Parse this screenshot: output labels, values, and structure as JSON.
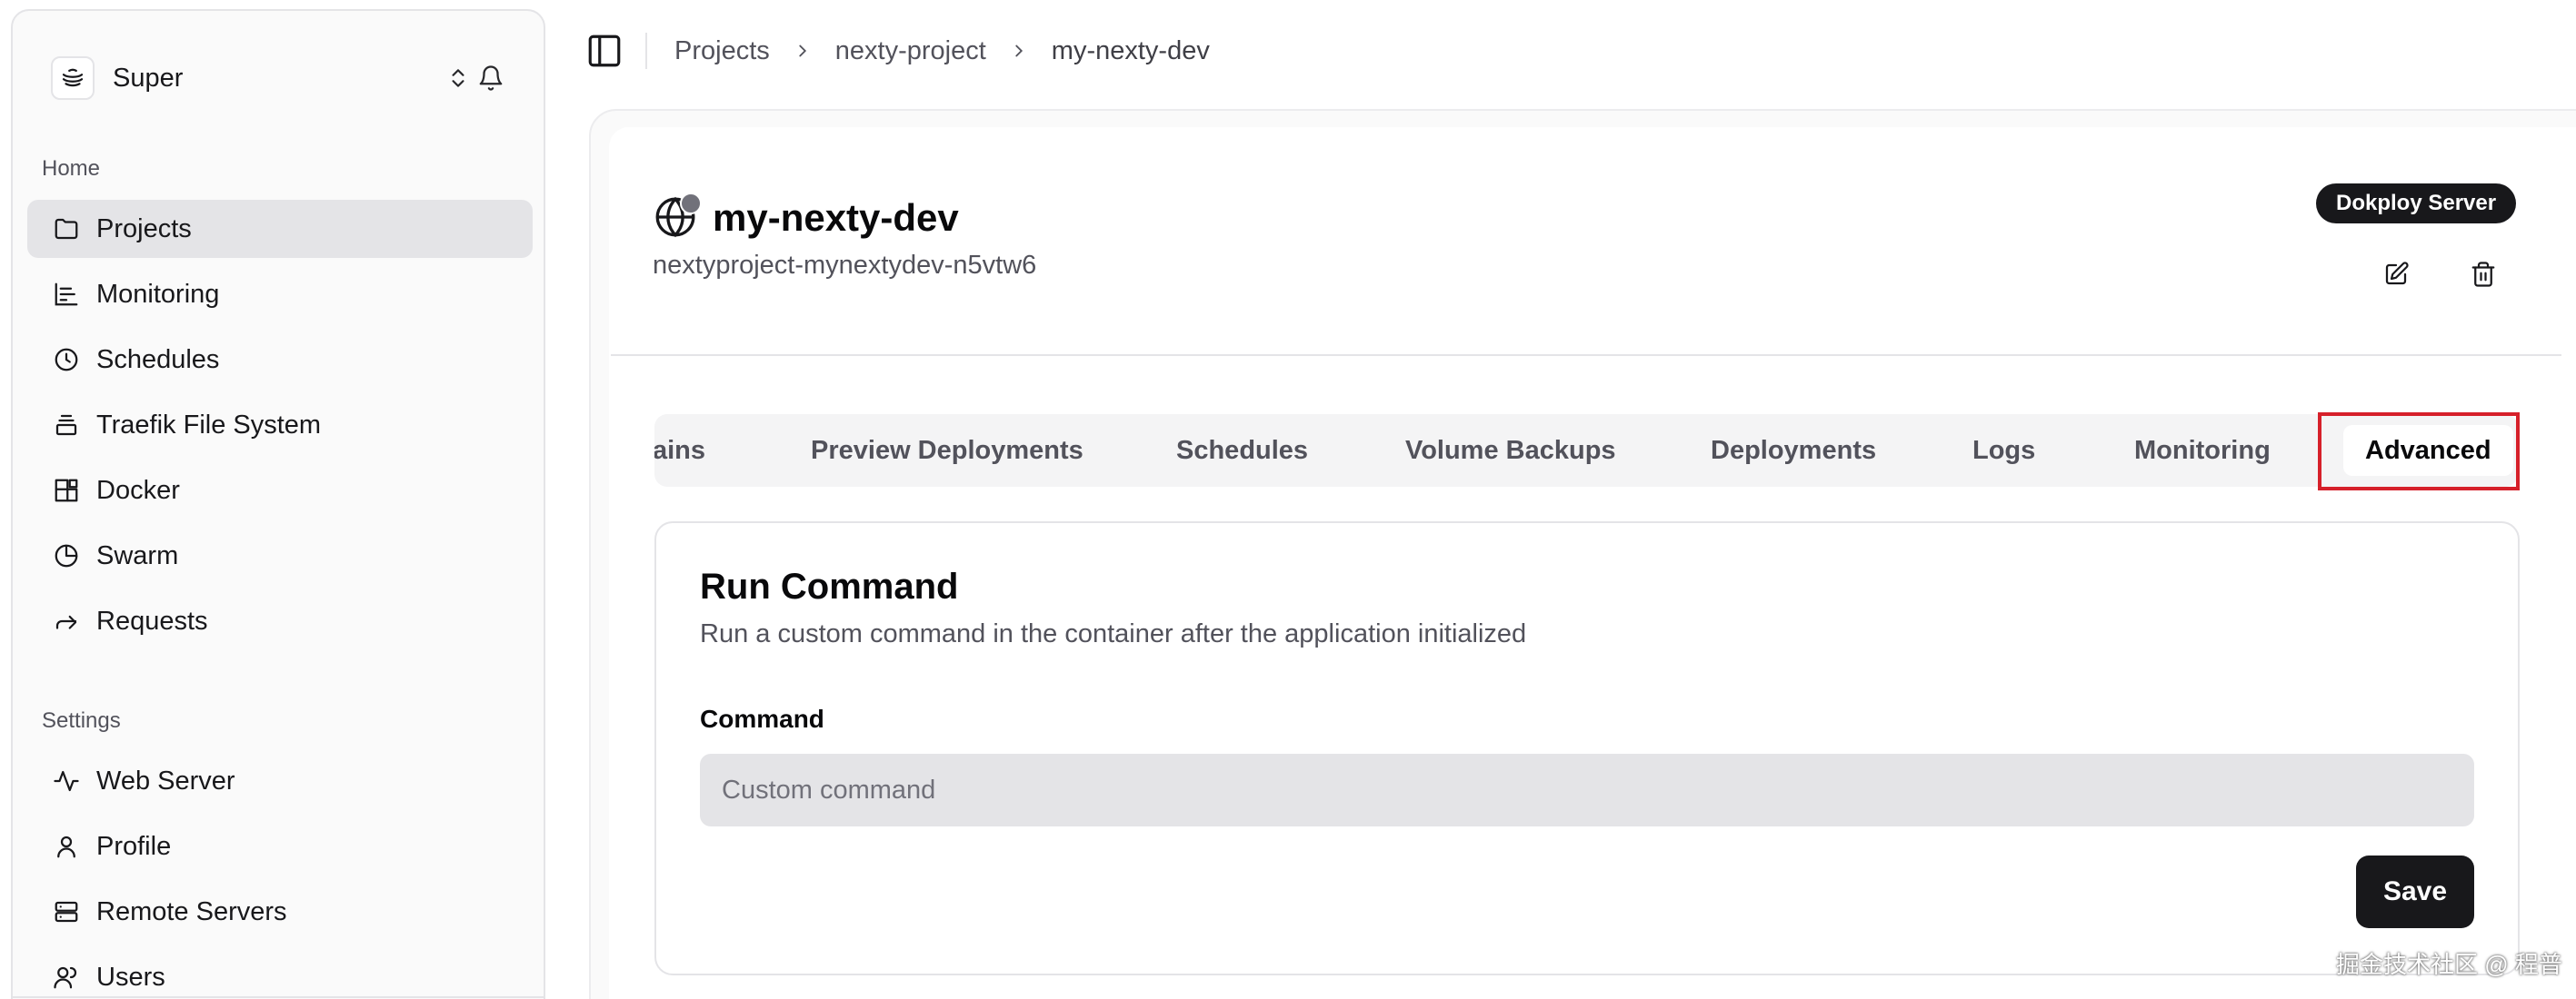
{
  "sidebar": {
    "team": {
      "name": "Super"
    },
    "home_label": "Home",
    "settings_label": "Settings",
    "home_items": [
      {
        "label": "Projects",
        "icon": "folder-icon",
        "active": true
      },
      {
        "label": "Monitoring",
        "icon": "bar-chart-icon"
      },
      {
        "label": "Schedules",
        "icon": "clock-icon"
      },
      {
        "label": "Traefik File System",
        "icon": "file-stack-icon"
      },
      {
        "label": "Docker",
        "icon": "blocks-icon"
      },
      {
        "label": "Swarm",
        "icon": "pie-chart-icon"
      },
      {
        "label": "Requests",
        "icon": "forward-arrow-icon"
      }
    ],
    "settings_items": [
      {
        "label": "Web Server",
        "icon": "activity-icon"
      },
      {
        "label": "Profile",
        "icon": "user-icon"
      },
      {
        "label": "Remote Servers",
        "icon": "server-icon"
      },
      {
        "label": "Users",
        "icon": "users-icon"
      }
    ]
  },
  "breadcrumb": [
    "Projects",
    "nexty-project",
    "my-nexty-dev"
  ],
  "app": {
    "title": "my-nexty-dev",
    "subtitle": "nextyproject-mynextydev-n5vtw6",
    "server_badge": "Dokploy Server"
  },
  "tabs": [
    {
      "label": "ains"
    },
    {
      "label": "Preview Deployments"
    },
    {
      "label": "Schedules"
    },
    {
      "label": "Volume Backups"
    },
    {
      "label": "Deployments"
    },
    {
      "label": "Logs"
    },
    {
      "label": "Monitoring"
    },
    {
      "label": "Advanced",
      "active": true
    }
  ],
  "run_command": {
    "title": "Run Command",
    "description": "Run a custom command in the container after the application initialized",
    "field_label": "Command",
    "input_value": "",
    "input_placeholder": "Custom command",
    "save_label": "Save"
  },
  "watermark": "掘金技术社区 @ 程普",
  "colors": {
    "accent": "#18181b",
    "highlight": "#d6202a",
    "active_nav_bg": "#e4e4e7",
    "status_dot": "#71717a"
  }
}
